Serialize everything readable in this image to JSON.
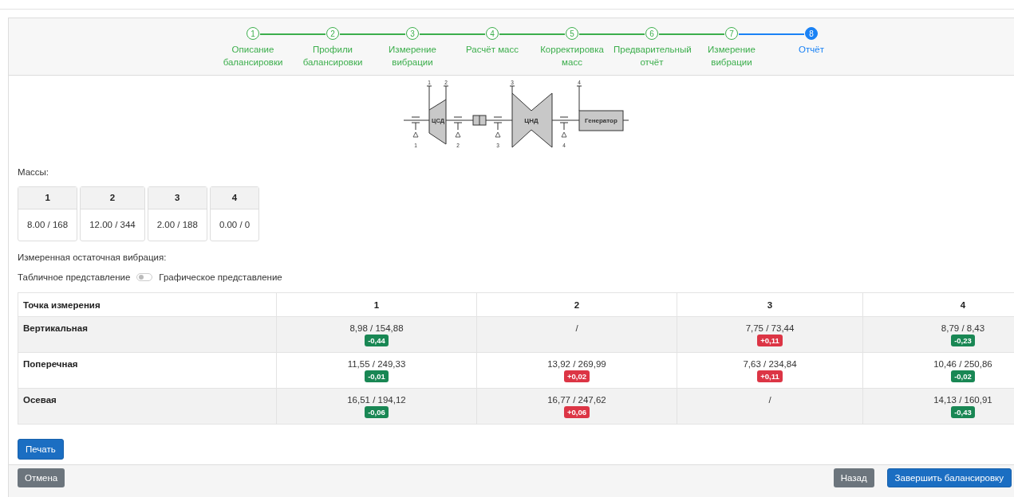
{
  "steps": [
    {
      "number": "1",
      "label": "Описание балансировки",
      "completed": true,
      "selected": false
    },
    {
      "number": "2",
      "label": "Профили балансировки",
      "completed": true,
      "selected": false
    },
    {
      "number": "3",
      "label": "Измерение вибрации",
      "completed": true,
      "selected": false
    },
    {
      "number": "4",
      "label": "Расчёт масс",
      "completed": true,
      "selected": false
    },
    {
      "number": "5",
      "label": "Корректировка масс",
      "completed": true,
      "selected": false
    },
    {
      "number": "6",
      "label": "Предварительный отчёт",
      "completed": true,
      "selected": false
    },
    {
      "number": "7",
      "label": "Измерение вибрации",
      "completed": true,
      "selected": false
    },
    {
      "number": "8",
      "label": "Отчёт",
      "completed": false,
      "selected": true
    }
  ],
  "diagram": {
    "lead_labels": [
      "1",
      "2",
      "3",
      "4"
    ],
    "bearing_labels": [
      "1",
      "2",
      "3",
      "4"
    ],
    "units": [
      "ЦСД",
      "ЦНД",
      "Генератор"
    ]
  },
  "masses": {
    "title": "Массы:",
    "items": [
      {
        "header": "1",
        "value": "8.00 / 168"
      },
      {
        "header": "2",
        "value": "12.00 / 344"
      },
      {
        "header": "3",
        "value": "2.00 / 188"
      },
      {
        "header": "4",
        "value": "0.00 / 0"
      }
    ]
  },
  "vibration_title": "Измеренная остаточная вибрация:",
  "view_toggle": {
    "left_label": "Табличное представление",
    "right_label": "Графическое представление",
    "on": false
  },
  "table": {
    "columns": [
      "Точка измерения",
      "1",
      "2",
      "3",
      "4"
    ],
    "rows": [
      {
        "cells": [
          {
            "value": "Вертикальная",
            "kind": "label"
          },
          {
            "value": "8,98 / 154,88",
            "delta": "-0,44",
            "kind": "decrease"
          },
          {
            "value": "/",
            "kind": "empty"
          },
          {
            "value": "7,75 / 73,44",
            "delta": "+0,11",
            "kind": "increase"
          },
          {
            "value": "8,79 / 8,43",
            "delta": "-0,23",
            "kind": "decrease"
          }
        ]
      },
      {
        "cells": [
          {
            "value": "Поперечная",
            "kind": "label"
          },
          {
            "value": "11,55 / 249,33",
            "delta": "-0,01",
            "kind": "decrease"
          },
          {
            "value": "13,92 / 269,99",
            "delta": "+0,02",
            "kind": "increase"
          },
          {
            "value": "7,63 / 234,84",
            "delta": "+0,11",
            "kind": "increase"
          },
          {
            "value": "10,46 / 250,86",
            "delta": "-0,02",
            "kind": "decrease"
          }
        ]
      },
      {
        "cells": [
          {
            "value": "Осевая",
            "kind": "label"
          },
          {
            "value": "16,51 / 194,12",
            "delta": "-0,06",
            "kind": "decrease"
          },
          {
            "value": "16,77 / 247,62",
            "delta": "+0,06",
            "kind": "increase"
          },
          {
            "value": "/",
            "kind": "empty"
          },
          {
            "value": "14,13 / 160,91",
            "delta": "-0,43",
            "kind": "decrease"
          }
        ]
      }
    ]
  },
  "print_button": "Печать",
  "footer": {
    "cancel": "Отмена",
    "back": "Назад",
    "finish": "Завершить балансировку"
  }
}
